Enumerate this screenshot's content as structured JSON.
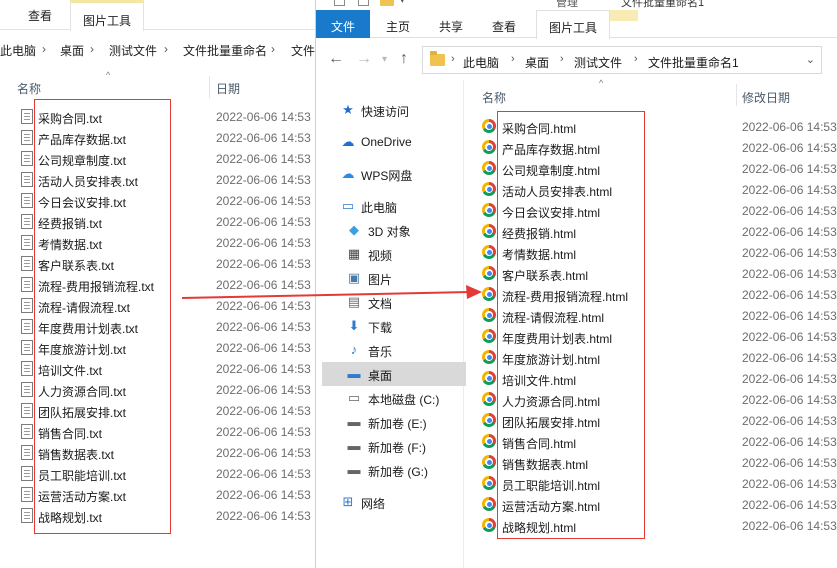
{
  "back_window": {
    "tabs": {
      "view": "查看",
      "picture_tools": "图片工具"
    },
    "breadcrumb": [
      "此电脑",
      "桌面",
      "测试文件",
      "文件批量重命名",
      "文件"
    ],
    "columns": {
      "name": "名称",
      "date": "日期"
    },
    "files": [
      {
        "name": "采购合同.txt",
        "date": "2022-06-06 14:53"
      },
      {
        "name": "产品库存数据.txt",
        "date": "2022-06-06 14:53"
      },
      {
        "name": "公司规章制度.txt",
        "date": "2022-06-06 14:53"
      },
      {
        "name": "活动人员安排表.txt",
        "date": "2022-06-06 14:53"
      },
      {
        "name": "今日会议安排.txt",
        "date": "2022-06-06 14:53"
      },
      {
        "name": "经费报销.txt",
        "date": "2022-06-06 14:53"
      },
      {
        "name": "考情数据.txt",
        "date": "2022-06-06 14:53"
      },
      {
        "name": "客户联系表.txt",
        "date": "2022-06-06 14:53"
      },
      {
        "name": "流程-费用报销流程.txt",
        "date": "2022-06-06 14:53"
      },
      {
        "name": "流程-请假流程.txt",
        "date": "2022-06-06 14:53"
      },
      {
        "name": "年度费用计划表.txt",
        "date": "2022-06-06 14:53"
      },
      {
        "name": "年度旅游计划.txt",
        "date": "2022-06-06 14:53"
      },
      {
        "name": "培训文件.txt",
        "date": "2022-06-06 14:53"
      },
      {
        "name": "人力资源合同.txt",
        "date": "2022-06-06 14:53"
      },
      {
        "name": "团队拓展安排.txt",
        "date": "2022-06-06 14:53"
      },
      {
        "name": "销售合同.txt",
        "date": "2022-06-06 14:53"
      },
      {
        "name": "销售数据表.txt",
        "date": "2022-06-06 14:53"
      },
      {
        "name": "员工职能培训.txt",
        "date": "2022-06-06 14:53"
      },
      {
        "name": "运营活动方案.txt",
        "date": "2022-06-06 14:53"
      },
      {
        "name": "战略规划.txt",
        "date": "2022-06-06 14:53"
      }
    ]
  },
  "front_window": {
    "title_context_label": "管理",
    "title": "文件批量重命名1",
    "tabs": {
      "file": "文件",
      "home": "主页",
      "share": "共享",
      "view": "查看",
      "picture_tools": "图片工具"
    },
    "breadcrumb": [
      "此电脑",
      "桌面",
      "测试文件",
      "文件批量重命名1"
    ],
    "nav_items": [
      {
        "label": "快速访问",
        "icon": "star-icon"
      },
      {
        "label": "OneDrive",
        "icon": "cloud-icon"
      },
      {
        "label": "WPS网盘",
        "icon": "wps-cloud-icon"
      },
      {
        "label": "此电脑",
        "icon": "computer-icon"
      },
      {
        "label": "3D 对象",
        "icon": "cube-icon"
      },
      {
        "label": "视频",
        "icon": "video-icon"
      },
      {
        "label": "图片",
        "icon": "picture-icon"
      },
      {
        "label": "文档",
        "icon": "document-icon"
      },
      {
        "label": "下载",
        "icon": "download-icon"
      },
      {
        "label": "音乐",
        "icon": "music-icon"
      },
      {
        "label": "桌面",
        "icon": "desktop-icon"
      },
      {
        "label": "本地磁盘 (C:)",
        "icon": "disk-icon"
      },
      {
        "label": "新加卷 (E:)",
        "icon": "drive-icon"
      },
      {
        "label": "新加卷 (F:)",
        "icon": "drive-icon"
      },
      {
        "label": "新加卷 (G:)",
        "icon": "drive-icon"
      },
      {
        "label": "网络",
        "icon": "network-icon"
      }
    ],
    "columns": {
      "name": "名称",
      "date": "修改日期"
    },
    "files": [
      {
        "name": "采购合同.html",
        "date": "2022-06-06 14:53"
      },
      {
        "name": "产品库存数据.html",
        "date": "2022-06-06 14:53"
      },
      {
        "name": "公司规章制度.html",
        "date": "2022-06-06 14:53"
      },
      {
        "name": "活动人员安排表.html",
        "date": "2022-06-06 14:53"
      },
      {
        "name": "今日会议安排.html",
        "date": "2022-06-06 14:53"
      },
      {
        "name": "经费报销.html",
        "date": "2022-06-06 14:53"
      },
      {
        "name": "考情数据.html",
        "date": "2022-06-06 14:53"
      },
      {
        "name": "客户联系表.html",
        "date": "2022-06-06 14:53"
      },
      {
        "name": "流程-费用报销流程.html",
        "date": "2022-06-06 14:53"
      },
      {
        "name": "流程-请假流程.html",
        "date": "2022-06-06 14:53"
      },
      {
        "name": "年度费用计划表.html",
        "date": "2022-06-06 14:53"
      },
      {
        "name": "年度旅游计划.html",
        "date": "2022-06-06 14:53"
      },
      {
        "name": "培训文件.html",
        "date": "2022-06-06 14:53"
      },
      {
        "name": "人力资源合同.html",
        "date": "2022-06-06 14:53"
      },
      {
        "name": "团队拓展安排.html",
        "date": "2022-06-06 14:53"
      },
      {
        "name": "销售合同.html",
        "date": "2022-06-06 14:53"
      },
      {
        "name": "销售数据表.html",
        "date": "2022-06-06 14:53"
      },
      {
        "name": "员工职能培训.html",
        "date": "2022-06-06 14:53"
      },
      {
        "name": "运营活动方案.html",
        "date": "2022-06-06 14:53"
      },
      {
        "name": "战略规划.html",
        "date": "2022-06-06 14:53"
      }
    ]
  },
  "colors": {
    "file_tab": "#1979ca",
    "context_tab": "#f7ecb5",
    "annotation": "#e53935",
    "selected_nav": "#d9d9d9"
  }
}
